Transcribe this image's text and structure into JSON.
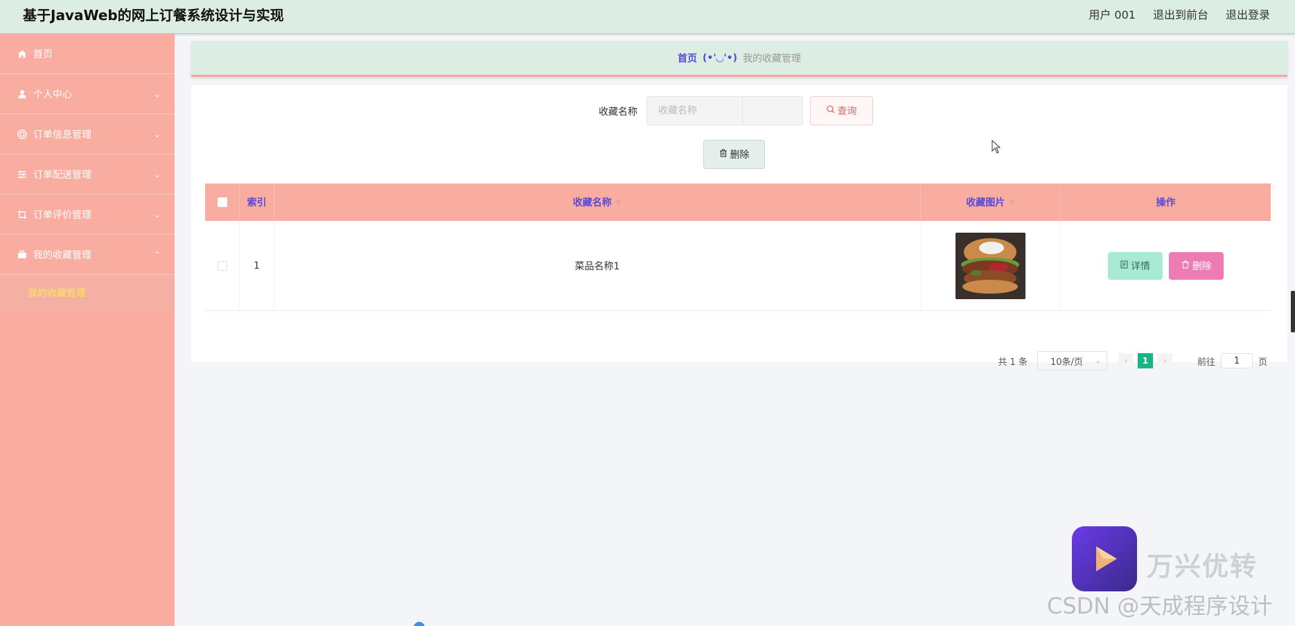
{
  "header": {
    "title": "基于JavaWeb的网上订餐系统设计与实现",
    "user": "用户 001",
    "exit_front": "退出到前台",
    "logout": "退出登录"
  },
  "sidebar": {
    "items": [
      {
        "label": "首页",
        "icon": "home-icon"
      },
      {
        "label": "个人中心",
        "icon": "user-icon"
      },
      {
        "label": "订单信息管理",
        "icon": "order-icon"
      },
      {
        "label": "订单配送管理",
        "icon": "sliders-icon"
      },
      {
        "label": "订单评价管理",
        "icon": "crop-icon"
      },
      {
        "label": "我的收藏管理",
        "icon": "briefcase-icon"
      }
    ],
    "submenu_label": "我的收藏管理",
    "background": "#f8ada0",
    "active_color": "#ffe65a"
  },
  "breadcrumb": {
    "home": "首页",
    "face": "(•'◡'•)",
    "current": "我的收藏管理"
  },
  "search": {
    "label": "收藏名称",
    "placeholder": "收藏名称",
    "button": "查询"
  },
  "toolbar": {
    "delete_label": "删除"
  },
  "table": {
    "headers": {
      "index": "索引",
      "name": "收藏名称",
      "image": "收藏图片",
      "ops": "操作"
    },
    "rows": [
      {
        "index": "1",
        "name": "菜品名称1",
        "detail": "详情",
        "delete": "删除"
      }
    ],
    "header_bg": "#f8ada0",
    "header_color": "#5a4ad6"
  },
  "pagination": {
    "total": "共 1 条",
    "page_size": "10条/页",
    "current_page": "1",
    "goto_label": "前往",
    "goto_value": "1",
    "page_suffix": "页"
  },
  "watermark": {
    "brand": "万兴优转",
    "csdn": "CSDN @天成程序设计"
  }
}
